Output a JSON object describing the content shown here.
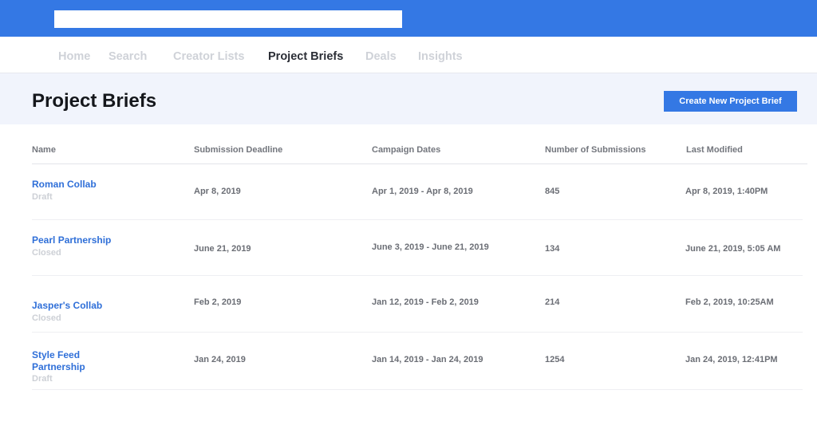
{
  "colors": {
    "brand": "#3478e4",
    "link": "#2f6fd8",
    "header_band": "#f1f4fc"
  },
  "nav": {
    "items": [
      {
        "label": "Home",
        "active": false
      },
      {
        "label": "Search",
        "active": false
      },
      {
        "label": "Creator Lists",
        "active": false
      },
      {
        "label": "Project Briefs",
        "active": true
      },
      {
        "label": "Deals",
        "active": false
      },
      {
        "label": "Insights",
        "active": false
      }
    ]
  },
  "page": {
    "title": "Project Briefs",
    "create_button": "Create New Project Brief"
  },
  "table": {
    "columns": [
      "Name",
      "Submission Deadline",
      "Campaign Dates",
      "Number of Submissions",
      "Last Modified"
    ],
    "rows": [
      {
        "name": "Roman Collab",
        "status": "Draft",
        "deadline": "Apr 8, 2019",
        "campaign": "Apr 1, 2019 - Apr 8, 2019",
        "submissions": "845",
        "modified": "Apr 8, 2019, 1:40PM"
      },
      {
        "name": "Pearl Partnership",
        "status": "Closed",
        "deadline": "June 21, 2019",
        "campaign": "June 3, 2019 - June 21, 2019",
        "submissions": "134",
        "modified": "June 21, 2019, 5:05 AM"
      },
      {
        "name": "Jasper's Collab",
        "status": "Closed",
        "deadline": "Feb 2, 2019",
        "campaign": "Jan 12, 2019 - Feb 2, 2019",
        "submissions": "214",
        "modified": "Feb 2, 2019, 10:25AM"
      },
      {
        "name": "Style Feed Partnership",
        "status": "Draft",
        "deadline": "Jan 24, 2019",
        "campaign": "Jan 14, 2019 - Jan 24, 2019",
        "submissions": "1254",
        "modified": "Jan 24, 2019, 12:41PM"
      }
    ]
  }
}
